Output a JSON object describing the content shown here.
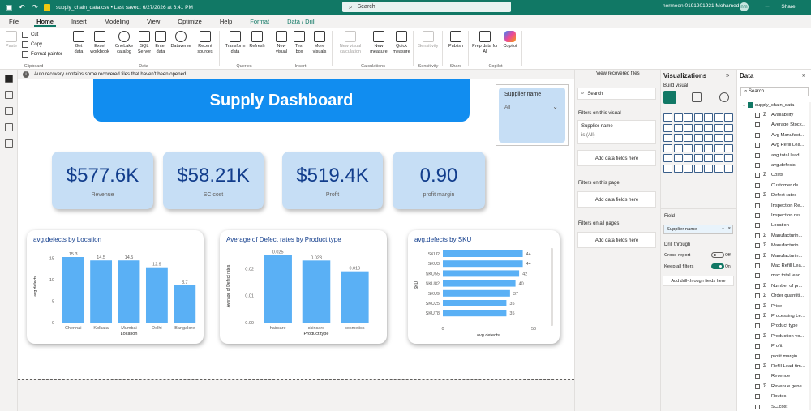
{
  "titlebar": {
    "filename": "supply_chain_data.csv • Last saved: 6/27/2026 at 6:41 PM",
    "search_placeholder": "Search",
    "user": "nermeen 0191201921 Mohamed"
  },
  "menu": {
    "tabs": [
      "File",
      "Home",
      "Insert",
      "Modeling",
      "View",
      "Optimize",
      "Help",
      "Format",
      "Data / Drill"
    ],
    "active": "Home",
    "share_label": "Share"
  },
  "ribbon": {
    "clipboard": {
      "label": "Clipboard",
      "paste": "Paste",
      "cut": "Cut",
      "copy": "Copy",
      "format_painter": "Format painter"
    },
    "data": {
      "label": "Data",
      "get_data": "Get data",
      "excel": "Excel workbook",
      "onelake": "OneLake catalog",
      "sql": "SQL Server",
      "enter": "Enter data",
      "dataverse": "Dataverse",
      "recent": "Recent sources"
    },
    "queries": {
      "label": "Queries",
      "transform": "Transform data",
      "refresh": "Refresh"
    },
    "insert": {
      "label": "Insert",
      "new_visual": "New visual",
      "text_box": "Text box",
      "more_visuals": "More visuals"
    },
    "calculations": {
      "label": "Calculations",
      "new_visual_calc": "New visual calculation",
      "new_measure": "New measure",
      "quick_measure": "Quick measure"
    },
    "sensitivity": {
      "label": "Sensitivity",
      "btn": "Sensitivity"
    },
    "share": {
      "label": "Share",
      "publish": "Publish"
    },
    "copilot": {
      "label": "Copilot",
      "prep": "Prep data for AI",
      "copilot": "Copilot"
    }
  },
  "recovery": {
    "message": "Auto recovery contains some recovered files that haven't been opened.",
    "link": "View recovered files"
  },
  "dashboard": {
    "title": "Supply Dashboard",
    "slicer": {
      "title": "Supplier name",
      "value": "All"
    },
    "cards": [
      {
        "value": "$577.6K",
        "label": "Revenue"
      },
      {
        "value": "$58.21K",
        "label": "SC.cost"
      },
      {
        "value": "$519.4K",
        "label": "Profit"
      },
      {
        "value": "0.90",
        "label": "profit margin"
      }
    ]
  },
  "chart_data": [
    {
      "type": "bar",
      "title": "avg.defects by Location",
      "xlabel": "Location",
      "ylabel": "avg.defects",
      "categories": [
        "Chennai",
        "Kolkata",
        "Mumbai",
        "Delhi",
        "Bangalore"
      ],
      "values": [
        15.3,
        14.5,
        14.5,
        12.9,
        8.7
      ],
      "data_labels": [
        "15.3",
        "14.5",
        "14.5",
        "12.9",
        "8.7"
      ],
      "yticks": [
        "0",
        "5",
        "10",
        "15"
      ],
      "ylim": [
        0,
        17
      ],
      "color": "#5ab0f5"
    },
    {
      "type": "bar",
      "title": "Average of Defect rates by Product type",
      "xlabel": "Product type",
      "ylabel": "Average of Defect rates",
      "categories": [
        "haircare",
        "skincare",
        "cosmetics"
      ],
      "values": [
        0.025,
        0.023,
        0.019
      ],
      "data_labels": [
        "0.025",
        "0.023",
        "0.019"
      ],
      "yticks": [
        "0.00",
        "0.01",
        "0.02"
      ],
      "ylim": [
        0,
        0.027
      ],
      "color": "#5ab0f5"
    },
    {
      "type": "bar",
      "orientation": "horizontal",
      "title": "avg.defects by SKU",
      "xlabel": "avg.defects",
      "ylabel": "SKU",
      "categories": [
        "SKU2",
        "SKU3",
        "SKU55",
        "SKU82",
        "SKU9",
        "SKU25",
        "SKU78"
      ],
      "values": [
        44,
        44,
        42,
        40,
        37,
        35,
        35
      ],
      "data_labels": [
        "44",
        "44",
        "42",
        "40",
        "37",
        "35",
        "35"
      ],
      "xticks": [
        "0",
        "50"
      ],
      "xlim": [
        0,
        50
      ],
      "color": "#5ab0f5"
    }
  ],
  "filters": {
    "search_placeholder": "Search",
    "on_visual": "Filters on this visual",
    "visual_field": "Supplier name",
    "visual_condition": "is (All)",
    "add_label": "Add data fields here",
    "on_page": "Filters on this page",
    "on_all": "Filters on all pages"
  },
  "visualizations": {
    "title": "Visualizations",
    "build": "Build visual",
    "field_label": "Field",
    "field_value": "Supplier name",
    "drill": "Drill through",
    "cross_report": "Cross-report",
    "cross_state": "Off",
    "keep_filters": "Keep all filters",
    "keep_state": "On",
    "add_drill": "Add drill-through fields here"
  },
  "data_pane": {
    "title": "Data",
    "search_placeholder": "Search",
    "table": "supply_chain_data",
    "fields": [
      {
        "sig": "Σ",
        "name": "Availability"
      },
      {
        "sig": "",
        "name": "Average Stock..."
      },
      {
        "sig": "",
        "name": "Avg Manufact..."
      },
      {
        "sig": "",
        "name": "Avg Refill Lea..."
      },
      {
        "sig": "",
        "name": "avg total lead ..."
      },
      {
        "sig": "",
        "name": "avg.defects"
      },
      {
        "sig": "Σ",
        "name": "Costs"
      },
      {
        "sig": "",
        "name": "Customer de..."
      },
      {
        "sig": "Σ",
        "name": "Defect rates"
      },
      {
        "sig": "",
        "name": "Inspection Re..."
      },
      {
        "sig": "",
        "name": "Inspection res..."
      },
      {
        "sig": "",
        "name": "Location"
      },
      {
        "sig": "Σ",
        "name": "Manufacturin..."
      },
      {
        "sig": "Σ",
        "name": "Manufacturin..."
      },
      {
        "sig": "Σ",
        "name": "Manufacturin..."
      },
      {
        "sig": "",
        "name": "Max Refill Lea..."
      },
      {
        "sig": "",
        "name": "max total lead..."
      },
      {
        "sig": "Σ",
        "name": "Number of pr..."
      },
      {
        "sig": "Σ",
        "name": "Order quantiti..."
      },
      {
        "sig": "Σ",
        "name": "Price"
      },
      {
        "sig": "Σ",
        "name": "Processing Le..."
      },
      {
        "sig": "",
        "name": "Product type"
      },
      {
        "sig": "Σ",
        "name": "Production vo..."
      },
      {
        "sig": "",
        "name": "Profit"
      },
      {
        "sig": "",
        "name": "profit margin"
      },
      {
        "sig": "Σ",
        "name": "Refill Lead tim..."
      },
      {
        "sig": "",
        "name": "Revenue"
      },
      {
        "sig": "Σ",
        "name": "Revenue gene..."
      },
      {
        "sig": "",
        "name": "Routes"
      },
      {
        "sig": "",
        "name": "SC.cost"
      }
    ]
  }
}
